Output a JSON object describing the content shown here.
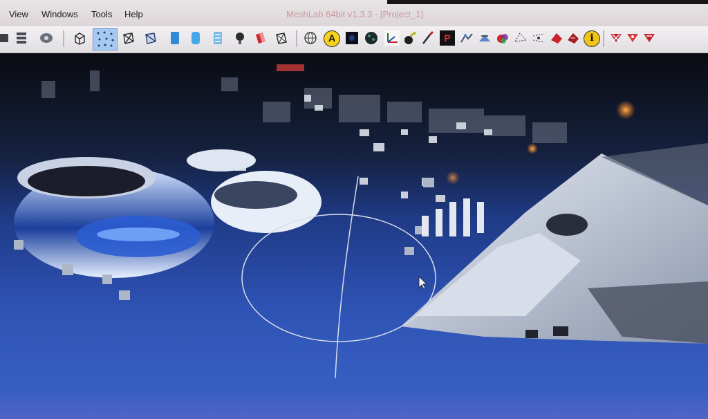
{
  "window": {
    "title": "MeshLab 64bit v1.3.3 - [Project_1]"
  },
  "menu": {
    "items": [
      "View",
      "Windows",
      "Tools",
      "Help"
    ]
  },
  "toolbar": {
    "info_glyph": "i",
    "text_glyph": "A",
    "pick_glyph": "P",
    "buttons": [
      "layers-icon",
      "snapshot-icon",
      "bounding-box-icon",
      "points-icon",
      "wireframe-icon",
      "hidden-lines-icon",
      "flat-icon",
      "smooth-icon",
      "texture-icon",
      "light-icon",
      "backface-icon",
      "double-side-icon",
      "trackball-icon",
      "annotate-icon",
      "shader-icon",
      "measure-icon",
      "axis-icon",
      "paint-icon",
      "brush-icon",
      "pick-icon",
      "align-icon",
      "transform-icon",
      "color-icon",
      "select-faces-icon",
      "select-vertices-icon",
      "select-connected-icon",
      "info-icon",
      "delete-faces-icon",
      "delete-vertices-icon",
      "delete-all-icon"
    ]
  },
  "colors": {
    "viewport_bottom": "#3a63c6",
    "trackball": "#d9dee8",
    "accent_red": "#c8232c"
  }
}
